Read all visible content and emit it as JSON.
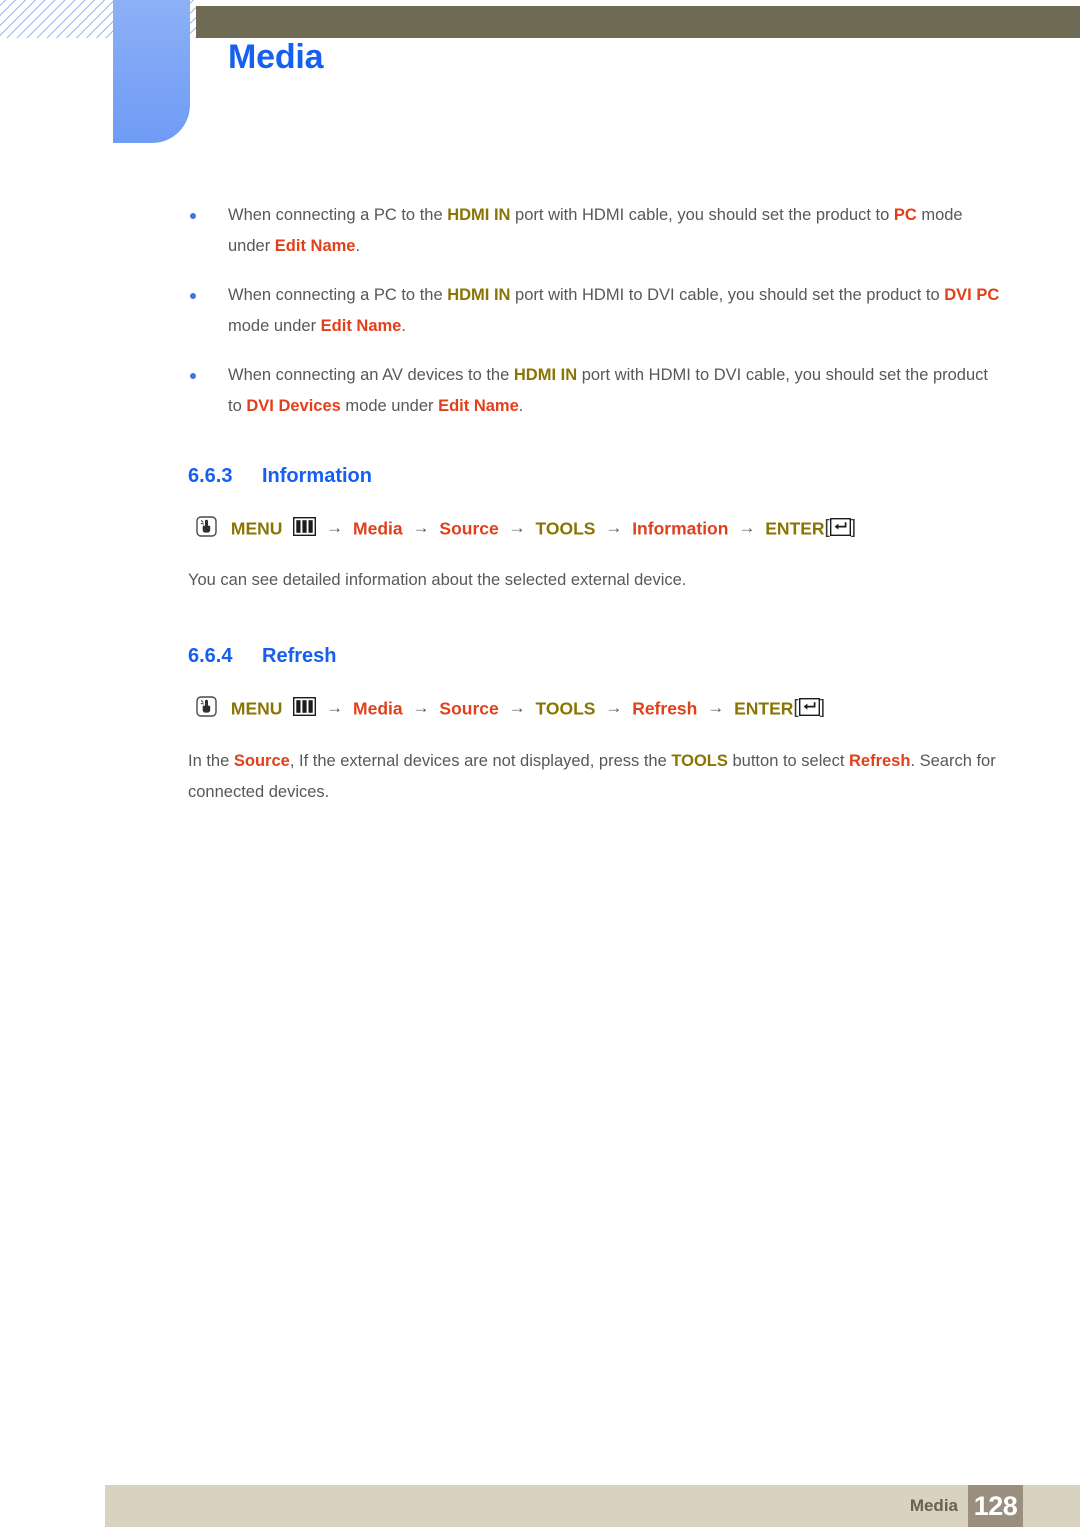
{
  "header": {
    "chapter_title": "Media"
  },
  "notes": [
    {
      "parts": [
        {
          "t": "When connecting a PC to the ",
          "s": "plain"
        },
        {
          "t": "HDMI IN",
          "s": "olive"
        },
        {
          "t": " port with HDMI cable, you should set the product to ",
          "s": "plain"
        },
        {
          "t": "PC",
          "s": "orange"
        },
        {
          "t": " mode under ",
          "s": "plain"
        },
        {
          "t": "Edit Name",
          "s": "orange"
        },
        {
          "t": ".",
          "s": "plain"
        }
      ]
    },
    {
      "parts": [
        {
          "t": "When connecting a PC to the ",
          "s": "plain"
        },
        {
          "t": "HDMI IN",
          "s": "olive"
        },
        {
          "t": " port with HDMI to DVI cable, you should set the product to ",
          "s": "plain"
        },
        {
          "t": "DVI PC",
          "s": "orange"
        },
        {
          "t": " mode under ",
          "s": "plain"
        },
        {
          "t": "Edit Name",
          "s": "orange"
        },
        {
          "t": ".",
          "s": "plain"
        }
      ]
    },
    {
      "parts": [
        {
          "t": "When connecting an AV devices to the ",
          "s": "plain"
        },
        {
          "t": "HDMI IN",
          "s": "olive"
        },
        {
          "t": " port with HDMI to DVI cable, you should set the product to ",
          "s": "plain"
        },
        {
          "t": "DVI Devices",
          "s": "orange"
        },
        {
          "t": " mode under ",
          "s": "plain"
        },
        {
          "t": "Edit Name",
          "s": "orange"
        },
        {
          "t": ".",
          "s": "plain"
        }
      ]
    }
  ],
  "sections": [
    {
      "number": "6.6.3",
      "title": "Information",
      "menu_path": {
        "press_icon": "press-hand-icon",
        "menu_label": "MENU",
        "grid_icon": "menu-grid-icon",
        "arrow": "→",
        "steps": [
          {
            "label": "Media",
            "style": "orange"
          },
          {
            "label": "Source",
            "style": "orange"
          },
          {
            "label": "TOOLS",
            "style": "olive"
          },
          {
            "label": "Information",
            "style": "orange"
          }
        ],
        "enter_label": "ENTER",
        "bracket_open": "[",
        "bracket_close": "]",
        "enter_icon": "enter-return-icon"
      },
      "body": "You can see detailed information about the selected external device."
    },
    {
      "number": "6.6.4",
      "title": "Refresh",
      "menu_path": {
        "press_icon": "press-hand-icon",
        "menu_label": "MENU",
        "grid_icon": "menu-grid-icon",
        "arrow": "→",
        "steps": [
          {
            "label": "Media",
            "style": "orange"
          },
          {
            "label": "Source",
            "style": "orange"
          },
          {
            "label": "TOOLS",
            "style": "olive"
          },
          {
            "label": "Refresh",
            "style": "orange"
          }
        ],
        "enter_label": "ENTER",
        "bracket_open": "[",
        "bracket_close": "]",
        "enter_icon": "enter-return-icon"
      },
      "body_parts": [
        {
          "t": "In the ",
          "s": "plain"
        },
        {
          "t": "Source",
          "s": "orange"
        },
        {
          "t": ", If the external devices are not displayed, press the ",
          "s": "plain"
        },
        {
          "t": "TOOLS",
          "s": "olive"
        },
        {
          "t": " button to select ",
          "s": "plain"
        },
        {
          "t": "Refresh",
          "s": "orange"
        },
        {
          "t": ". Search for connected devices.",
          "s": "plain"
        }
      ]
    }
  ],
  "footer": {
    "label": "Media",
    "page_number": "128"
  },
  "colors": {
    "heading_blue": "#1560f0",
    "accent_orange": "#e2401a",
    "accent_olive": "#8a7403",
    "body_gray": "#58585a",
    "olive_bar": "#6e6a54",
    "blue_tab": "#7fa6f6",
    "footer_bar": "#d8d2bf",
    "footer_page_box": "#9a8e7e"
  }
}
